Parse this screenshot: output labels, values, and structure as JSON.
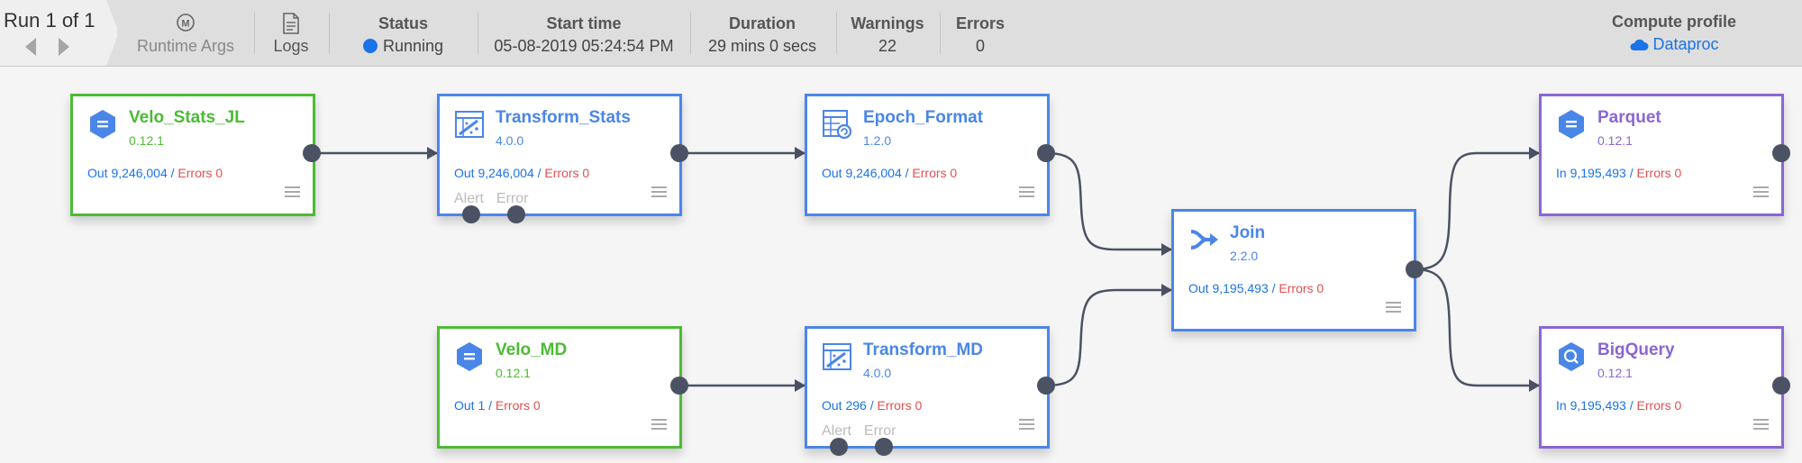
{
  "header": {
    "run_title": "Run 1 of 1",
    "runtime_args": "Runtime Args",
    "logs": "Logs",
    "status_label": "Status",
    "status_value": "Running",
    "start_label": "Start time",
    "start_value": "05-08-2019 05:24:54 PM",
    "duration_label": "Duration",
    "duration_value": "29 mins 0 secs",
    "warnings_label": "Warnings",
    "warnings_value": "22",
    "errors_label": "Errors",
    "errors_value": "0",
    "compute_label": "Compute profile",
    "compute_value": "Dataproc"
  },
  "colors": {
    "source": "#4cbb34",
    "transform": "#4a86e8",
    "sink": "#8a66d4",
    "out_text": "#1a73e8",
    "error_text": "#e15050",
    "edge": "#4a5264"
  },
  "nodes": {
    "velo_stats_jl": {
      "name": "Velo_Stats_JL",
      "version": "0.12.1",
      "metric": "Out 9,246,004",
      "sep": " / ",
      "errors": "Errors 0",
      "icon": "database-hex-icon"
    },
    "transform_stats": {
      "name": "Transform_Stats",
      "version": "4.0.0",
      "metric": "Out 9,246,004",
      "sep": " / ",
      "errors": "Errors 0",
      "alert": "Alert",
      "error": "Error",
      "icon": "wrangler-icon"
    },
    "epoch_format": {
      "name": "Epoch_Format",
      "version": "1.2.0",
      "metric": "Out 9,246,004",
      "sep": " / ",
      "errors": "Errors 0",
      "icon": "table-refresh-icon"
    },
    "join": {
      "name": "Join",
      "version": "2.2.0",
      "metric": "Out 9,195,493",
      "sep": " / ",
      "errors": "Errors 0",
      "icon": "join-icon"
    },
    "parquet": {
      "name": "Parquet",
      "version": "0.12.1",
      "metric": "In 9,195,493",
      "sep": " / ",
      "errors": "Errors 0",
      "icon": "database-hex-icon"
    },
    "velo_md": {
      "name": "Velo_MD",
      "version": "0.12.1",
      "metric": "Out 1",
      "sep": " / ",
      "errors": "Errors 0",
      "icon": "database-hex-icon"
    },
    "transform_md": {
      "name": "Transform_MD",
      "version": "4.0.0",
      "metric": "Out 296",
      "sep": " / ",
      "errors": "Errors 0",
      "alert": "Alert",
      "error": "Error",
      "icon": "wrangler-icon"
    },
    "bigquery": {
      "name": "BigQuery",
      "version": "0.12.1",
      "metric": "In 9,195,493",
      "sep": " / ",
      "errors": "Errors 0",
      "icon": "bigquery-icon"
    }
  }
}
